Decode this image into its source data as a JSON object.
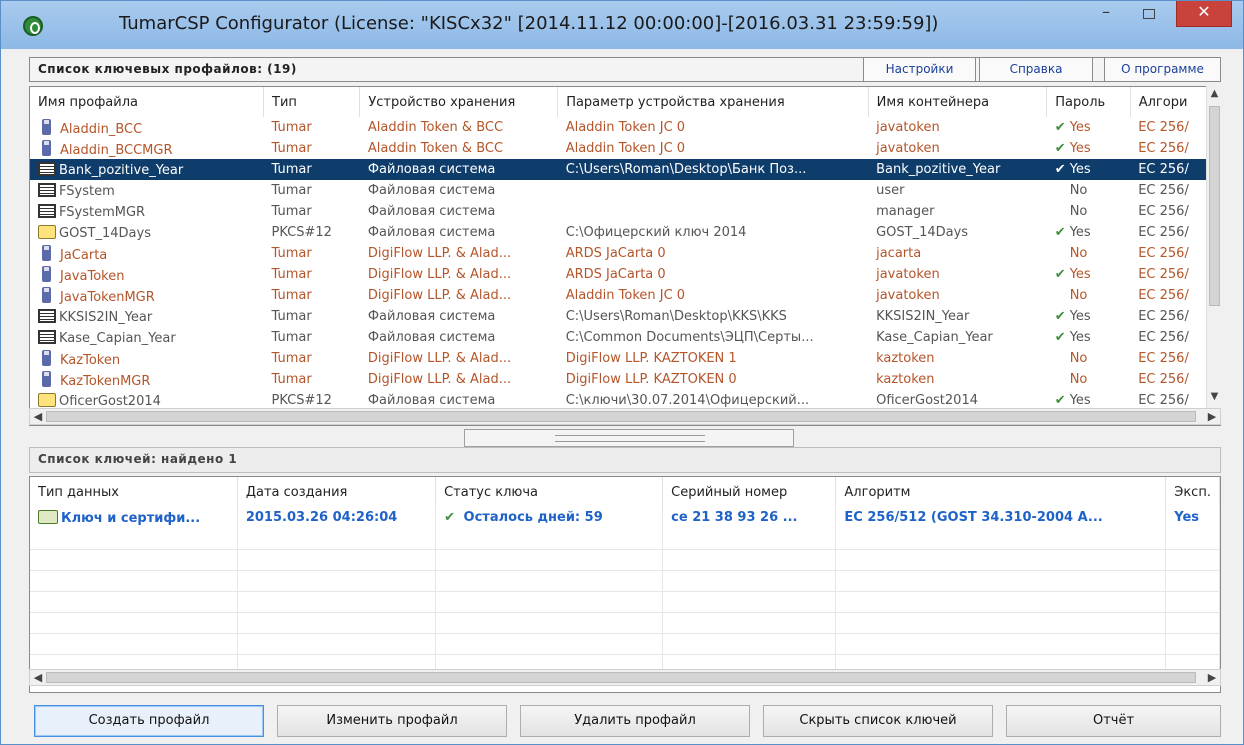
{
  "window": {
    "title": "TumarCSP Configurator (License: \"KISCx32\" [2014.11.12 00:00:00]-[2016.03.31 23:59:59])",
    "min_symbol": "–",
    "close_symbol": "✕"
  },
  "profiles": {
    "header": "Список ключевых профайлов: (19)",
    "links": {
      "settings": "Настройки",
      "help": "Справка",
      "about": "О программе"
    },
    "columns": [
      "Имя профайла",
      "Тип",
      "Устройство хранения",
      "Параметр устройства хранения",
      "Имя контейнера",
      "Пароль",
      "Алгори"
    ],
    "rows": [
      {
        "icon": "token-icon",
        "name": "Aladdin_BCC",
        "type": "Tumar",
        "device": "Aladdin Token & BCC",
        "param": "Aladdin Token JC 0",
        "container": "javatoken",
        "check": true,
        "password": "Yes",
        "alg": "EC 256/"
      },
      {
        "icon": "token-icon",
        "name": "Aladdin_BCCMGR",
        "type": "Tumar",
        "device": "Aladdin Token & BCC",
        "param": "Aladdin Token JC 0",
        "container": "javatoken",
        "check": true,
        "password": "Yes",
        "alg": "EC 256/"
      },
      {
        "icon": "filesystem-icon",
        "name": "Bank_pozitive_Year",
        "type": "Tumar",
        "device": "Файловая система",
        "param": "C:\\Users\\Roman\\Desktop\\Банк Поз...",
        "container": "Bank_pozitive_Year",
        "check": true,
        "password": "Yes",
        "alg": "EC 256/",
        "selected": true
      },
      {
        "icon": "filesystem-icon",
        "name": "FSystem",
        "type": "Tumar",
        "device": "Файловая система",
        "param": "",
        "container": "user",
        "check": false,
        "password": "No",
        "alg": "EC 256/"
      },
      {
        "icon": "filesystem-icon",
        "name": "FSystemMGR",
        "type": "Tumar",
        "device": "Файловая система",
        "param": "",
        "container": "manager",
        "check": false,
        "password": "No",
        "alg": "EC 256/"
      },
      {
        "icon": "pkcs-icon",
        "name": "GOST_14Days",
        "type": "PKCS#12",
        "device": "Файловая система",
        "param": "C:\\Офицерский ключ 2014",
        "container": "GOST_14Days",
        "check": true,
        "password": "Yes",
        "alg": "EC 256/"
      },
      {
        "icon": "token-icon",
        "name": "JaCarta",
        "type": "Tumar",
        "device": "DigiFlow LLP. & Alad...",
        "param": "ARDS JaCarta 0",
        "container": "jacarta",
        "check": false,
        "password": "No",
        "alg": "EC 256/"
      },
      {
        "icon": "token-icon",
        "name": "JavaToken",
        "type": "Tumar",
        "device": "DigiFlow LLP. & Alad...",
        "param": "ARDS JaCarta 0",
        "container": "javatoken",
        "check": true,
        "password": "Yes",
        "alg": "EC 256/"
      },
      {
        "icon": "token-icon",
        "name": "JavaTokenMGR",
        "type": "Tumar",
        "device": "DigiFlow LLP. & Alad...",
        "param": "Aladdin Token JC 0",
        "container": "javatoken",
        "check": false,
        "password": "No",
        "alg": "EC 256/"
      },
      {
        "icon": "filesystem-icon",
        "name": "KKSIS2IN_Year",
        "type": "Tumar",
        "device": "Файловая система",
        "param": "C:\\Users\\Roman\\Desktop\\KKS\\KKS",
        "container": "KKSIS2IN_Year",
        "check": true,
        "password": "Yes",
        "alg": "EC 256/"
      },
      {
        "icon": "filesystem-icon",
        "name": "Kase_Capian_Year",
        "type": "Tumar",
        "device": "Файловая система",
        "param": "C:\\Common Documents\\ЭЦП\\Серты...",
        "container": "Kase_Capian_Year",
        "check": true,
        "password": "Yes",
        "alg": "EC 256/"
      },
      {
        "icon": "token-icon",
        "name": "KazToken",
        "type": "Tumar",
        "device": "DigiFlow LLP. & Alad...",
        "param": "DigiFlow LLP. KAZTOKEN 1",
        "container": "kaztoken",
        "check": false,
        "password": "No",
        "alg": "EC 256/"
      },
      {
        "icon": "token-icon",
        "name": "KazTokenMGR",
        "type": "Tumar",
        "device": "DigiFlow LLP. & Alad...",
        "param": "DigiFlow LLP. KAZTOKEN 0",
        "container": "kaztoken",
        "check": false,
        "password": "No",
        "alg": "EC 256/"
      },
      {
        "icon": "pkcs-icon",
        "name": "OficerGost2014",
        "type": "PKCS#12",
        "device": "Файловая система",
        "param": "C:\\ключи\\30.07.2014\\Офицерский...",
        "container": "OficerGost2014",
        "check": true,
        "password": "Yes",
        "alg": "EC 256/"
      }
    ]
  },
  "keys": {
    "header": "Список ключей: найдено 1",
    "columns": [
      "Тип данных",
      "Дата создания",
      "Статус ключа",
      "Серийный номер",
      "Алгоритм",
      "Эксп."
    ],
    "rows": [
      {
        "type": "Ключ и сертифи...",
        "date": "2015.03.26 04:26:04",
        "status": "Осталось дней: 59",
        "serial": "ce 21 38 93 26 ...",
        "alg": "EC 256/512 (GOST 34.310-2004 A...",
        "exp": "Yes"
      }
    ]
  },
  "buttons": {
    "create": "Создать профайл",
    "edit": "Изменить профайл",
    "delete": "Удалить профайл",
    "hide": "Скрыть список ключей",
    "report": "Отчёт"
  }
}
